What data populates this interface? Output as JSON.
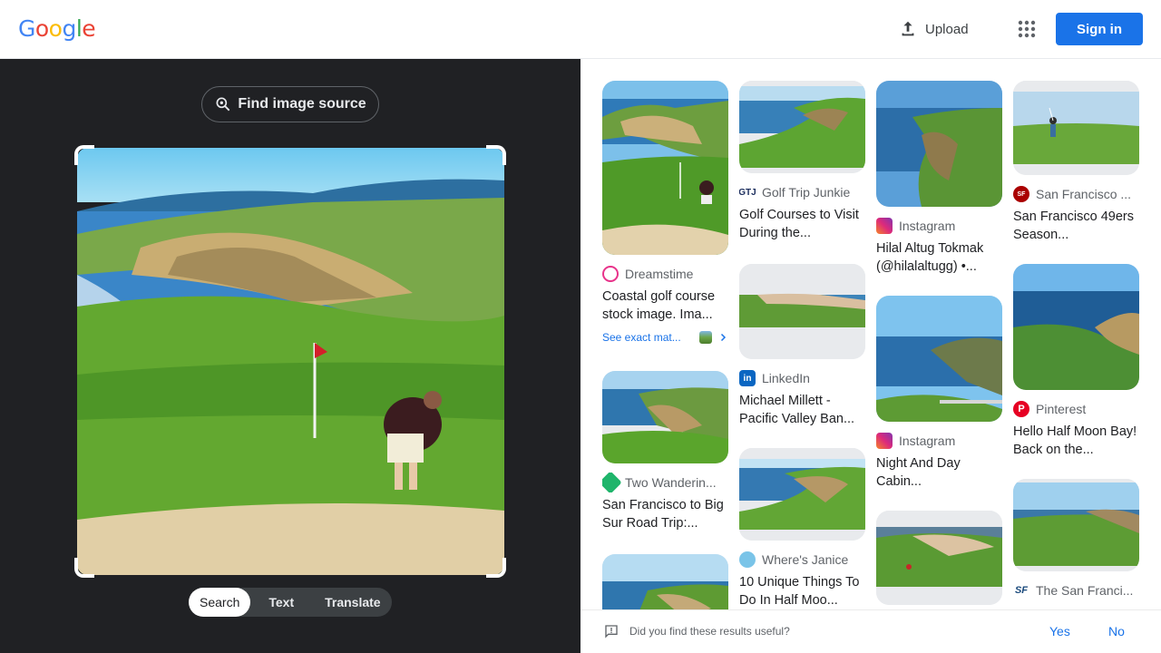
{
  "header": {
    "logo_letters": [
      "G",
      "o",
      "o",
      "g",
      "l",
      "e"
    ],
    "upload_label": "Upload",
    "signin_label": "Sign in"
  },
  "left_panel": {
    "find_source_label": "Find image source",
    "modes": [
      "Search",
      "Text",
      "Translate"
    ],
    "active_mode": "Search"
  },
  "results": {
    "col1": [
      {
        "source": "Dreamstime",
        "title": "Coastal golf course stock image. Ima...",
        "exact_match": "See exact mat..."
      },
      {
        "source": "Two Wanderin...",
        "title": "San Francisco to Big Sur Road Trip:..."
      },
      {
        "source": "",
        "title": ""
      }
    ],
    "col2": [
      {
        "source": "Golf Trip Junkie",
        "title": "Golf Courses to Visit During the..."
      },
      {
        "source": "LinkedIn",
        "title": "Michael Millett - Pacific Valley Ban..."
      },
      {
        "source": "Where's Janice",
        "title": "10 Unique Things To Do In Half Moo..."
      }
    ],
    "col3": [
      {
        "source": "Instagram",
        "title": "Hilal Altug Tokmak (@hilalaltugg) •..."
      },
      {
        "source": "Instagram",
        "title": "Night And Day Cabin..."
      },
      {
        "source": "",
        "title": ""
      }
    ],
    "col4": [
      {
        "source": "San Francisco ...",
        "title": "San Francisco 49ers Season..."
      },
      {
        "source": "Pinterest",
        "title": "Hello Half Moon Bay! Back on the..."
      },
      {
        "source": "The San Franci...",
        "title": ""
      }
    ]
  },
  "feedback": {
    "question": "Did you find these results useful?",
    "yes": "Yes",
    "no": "No"
  },
  "colors": {
    "accent": "#1a73e8",
    "dark_panel": "#202124",
    "dreamstime": "#e8338a",
    "linkedin": "#0a66c2",
    "instagram": "#d6249f",
    "pinterest": "#e60023",
    "niners": "#aa0000"
  },
  "icons": [
    "upload-icon",
    "apps-grid-icon",
    "lens-search-icon",
    "feedback-icon",
    "chevron-right-icon"
  ]
}
